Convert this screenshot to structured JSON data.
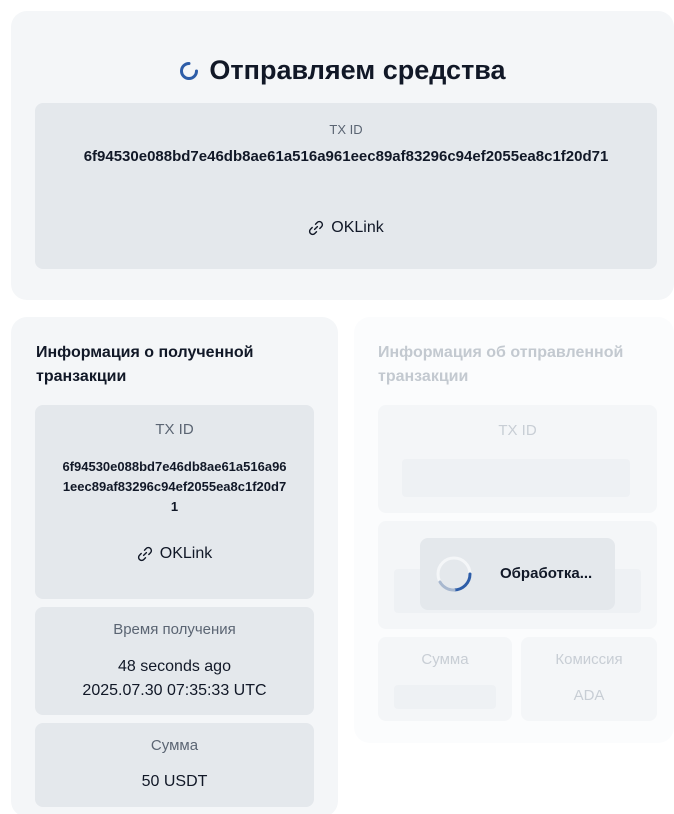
{
  "header": {
    "title": "Отправляем средства",
    "txid_label": "TX ID",
    "txid": "6f94530e088bd7e46db8ae61a516a961eec89af83296c94ef2055ea8c1f20d71",
    "explorer_link": "OKLink"
  },
  "received": {
    "title": "Информация о полученной транзакции",
    "txid_label": "TX ID",
    "txid": "6f94530e088bd7e46db8ae61a516a961eec89af83296c94ef2055ea8c1f20d71",
    "explorer_link": "OKLink",
    "time_label": "Время получения",
    "time_relative": "48 seconds ago",
    "time_absolute": "2025.07.30 07:35:33 UTC",
    "amount_label": "Сумма",
    "amount": "50 USDT"
  },
  "sent": {
    "title": "Информация об отправленной транзакции",
    "txid_label": "TX ID",
    "amount_label": "Сумма",
    "fee_label": "Комиссия",
    "fee_currency": "ADA"
  },
  "overlay": {
    "processing_label": "Обработка..."
  },
  "colors": {
    "accent": "#2d5da8",
    "card_bg": "#f4f6f8",
    "box_bg": "#e4e8ec",
    "muted_text": "#c3c9d0"
  }
}
